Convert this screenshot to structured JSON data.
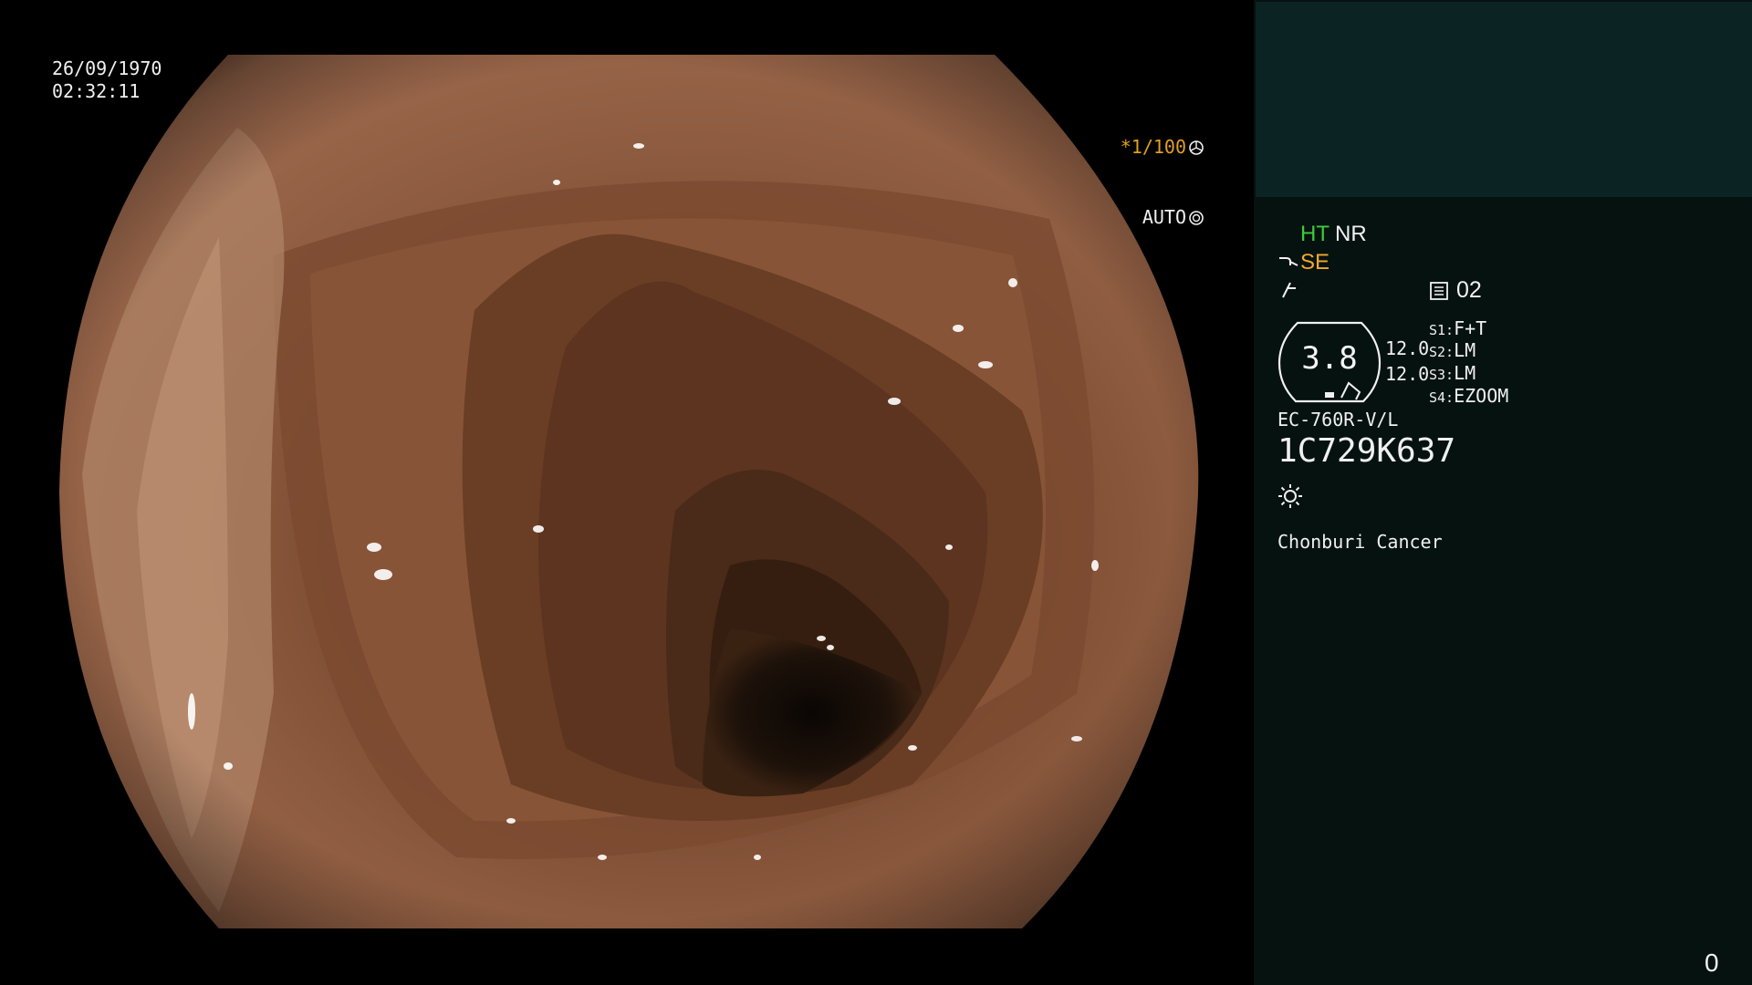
{
  "osd": {
    "date": "26/09/1970",
    "time": "02:32:11",
    "shutter_speed": "*1/100",
    "iris_mode": "AUTO"
  },
  "panel": {
    "ht": "HT",
    "nr": "NR",
    "se": "SE",
    "memo_number": "02",
    "scope_value": "3.8",
    "scale_top": "12.0",
    "scale_bottom": "12.0",
    "switches": [
      {
        "key": "S1:",
        "value": "F+T"
      },
      {
        "key": "S2:",
        "value": "LM"
      },
      {
        "key": "S3:",
        "value": "LM"
      },
      {
        "key": "S4:",
        "value": "EZOOM"
      }
    ],
    "scope_model": "EC-760R-V/L",
    "serial": "1C729K637",
    "hospital": "Chonburi Cancer",
    "counter": "0"
  },
  "colors": {
    "panel_bg": "#061210",
    "panel_top_bg": "#0c2324",
    "ht_green": "#3ccc3c",
    "se_orange": "#f0a830",
    "shutter_orange": "#e0a020"
  },
  "icons": {
    "shutter": "aperture-icon",
    "iris": "iris-icon",
    "hook": "hook-icon",
    "freeze": "freeze-icon",
    "memo": "memo-icon",
    "light": "light-icon"
  }
}
